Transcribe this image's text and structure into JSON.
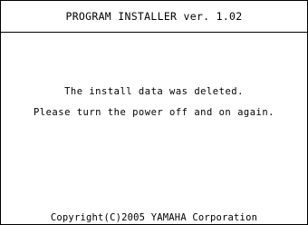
{
  "window": {
    "title": "PROGRAM INSTALLER ver. 1.02"
  },
  "message": {
    "line1": "The install data was deleted.",
    "line2": "Please turn the power off and on again."
  },
  "footer": {
    "copyright": "Copyright(C)2005 YAMAHA Corporation"
  }
}
